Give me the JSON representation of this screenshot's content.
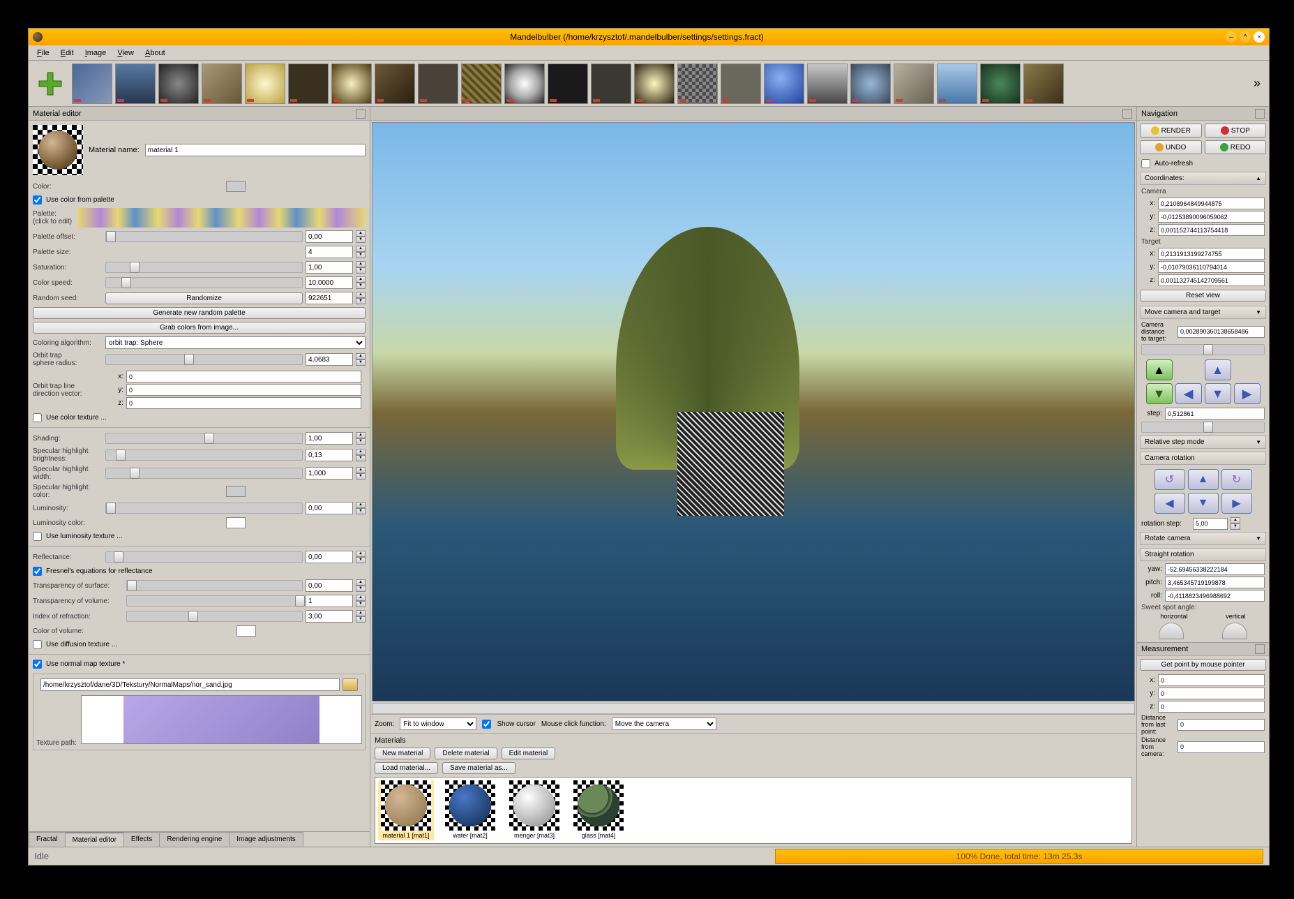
{
  "window": {
    "title": "Mandelbulber (/home/krzysztof/.mandelbulber/settings/settings.fract)"
  },
  "menubar": [
    "File",
    "Edit",
    "Image",
    "View",
    "About"
  ],
  "material_editor": {
    "title": "Material editor",
    "name_label": "Material name:",
    "name_value": "material 1",
    "color_label": "Color:",
    "use_palette": "Use color from palette",
    "palette_label": "Palette:\n(click to edit)",
    "palette_offset_label": "Palette offset:",
    "palette_offset_value": "0,00",
    "palette_size_label": "Palette size:",
    "palette_size_value": "4",
    "saturation_label": "Saturation:",
    "saturation_value": "1,00",
    "color_speed_label": "Color speed:",
    "color_speed_value": "10,0000",
    "random_seed_label": "Random seed:",
    "random_seed_value": "922651",
    "randomize_btn": "Randomize",
    "gen_palette_btn": "Generate new random palette",
    "grab_colors_btn": "Grab colors from image...",
    "coloring_algo_label": "Coloring algorithm:",
    "coloring_algo_value": "orbit trap: Sphere",
    "orbit_radius_label": "Orbit trap\nsphere radius:",
    "orbit_radius_value": "4,0683",
    "orbit_vector_label": "Orbit trap line\ndirection vector:",
    "orbit_x": "0",
    "orbit_y": "0",
    "orbit_z": "0",
    "use_color_texture": "Use color texture ...",
    "shading_label": "Shading:",
    "shading_value": "1,00",
    "spec_bright_label": "Specular highlight\nbrightness:",
    "spec_bright_value": "0,13",
    "spec_width_label": "Specular highlight\nwidth:",
    "spec_width_value": "1,000",
    "spec_color_label": "Specular highlight\ncolor:",
    "luminosity_label": "Luminosity:",
    "luminosity_value": "0,00",
    "luminosity_color_label": "Luminosity color:",
    "use_luminosity_texture": "Use luminosity texture ...",
    "reflectance_label": "Reflectance:",
    "reflectance_value": "0,00",
    "fresnel": "Fresnel's equations for reflectance",
    "transp_surface_label": "Transparency of surface:",
    "transp_surface_value": "0,00",
    "transp_volume_label": "Transparency of volume:",
    "transp_volume_value": "1",
    "ior_label": "Index of refraction:",
    "ior_value": "3,00",
    "color_volume_label": "Color of volume:",
    "use_diffusion_texture": "Use diffusion texture ...",
    "use_normal_map": "Use normal map texture *",
    "normal_map_path": "/home/krzysztof/dane/3D/Tekstury/NormalMaps/nor_sand.jpg",
    "texture_path_label": "Texture path:"
  },
  "bottom_tabs": [
    "Fractal",
    "Material editor",
    "Effects",
    "Rendering engine",
    "Image adjustments"
  ],
  "center": {
    "zoom_label": "Zoom:",
    "zoom_value": "Fit to window",
    "show_cursor": "Show cursor",
    "click_fn_label": "Mouse click function:",
    "click_fn_value": "Move the camera",
    "materials_title": "Materials",
    "new_material": "New material",
    "delete_material": "Delete material",
    "edit_material": "Edit material",
    "load_material": "Load material...",
    "save_material": "Save material as...",
    "materials": [
      {
        "name": "material 1 [mat1]"
      },
      {
        "name": "water [mat2]"
      },
      {
        "name": "menger [mat3]"
      },
      {
        "name": "glass [mat4]"
      }
    ]
  },
  "navigation": {
    "title": "Navigation",
    "render": "RENDER",
    "stop": "STOP",
    "undo": "UNDO",
    "redo": "REDO",
    "auto_refresh": "Auto-refresh",
    "coordinates_hdr": "Coordinates:",
    "camera_label": "Camera",
    "cam_x": "0,2108964849944875",
    "cam_y": "-0,01253890096059062",
    "cam_z": "0,001152744113754418",
    "target_label": "Target",
    "tgt_x": "0,2131913199274755",
    "tgt_y": "-0,01079036110794014",
    "tgt_z": "0,001132745142709561",
    "reset_view": "Reset view",
    "move_cam_hdr": "Move camera and target",
    "cam_dist_label": "Camera distance\nto target:",
    "cam_dist_value": "0,002890360138658486",
    "step_label": "step:",
    "step_value": "0,512861",
    "rel_step_hdr": "Relative step mode",
    "cam_rot_hdr": "Camera rotation",
    "rot_step_label": "rotation step:",
    "rot_step_value": "5,00",
    "rotate_cam_hdr": "Rotate camera",
    "straight_rot_hdr": "Straight rotation",
    "yaw_label": "yaw:",
    "yaw_value": "-52,69456338222184",
    "pitch_label": "pitch:",
    "pitch_value": "3,465345719199878",
    "roll_label": "roll:",
    "roll_value": "-0,4118823496988692",
    "sweet_spot_label": "Sweet spot angle:",
    "horizontal": "horizontal",
    "vertical": "vertical"
  },
  "measurement": {
    "title": "Measurement",
    "get_point": "Get point by mouse pointer",
    "x": "0",
    "y": "0",
    "z": "0",
    "dist_last_label": "Distance from last point:",
    "dist_last_value": "0",
    "dist_cam_label": "Distance from camera:",
    "dist_cam_value": "0"
  },
  "status": {
    "idle": "Idle",
    "progress": "100% Done, total time: 13m 25.3s"
  }
}
